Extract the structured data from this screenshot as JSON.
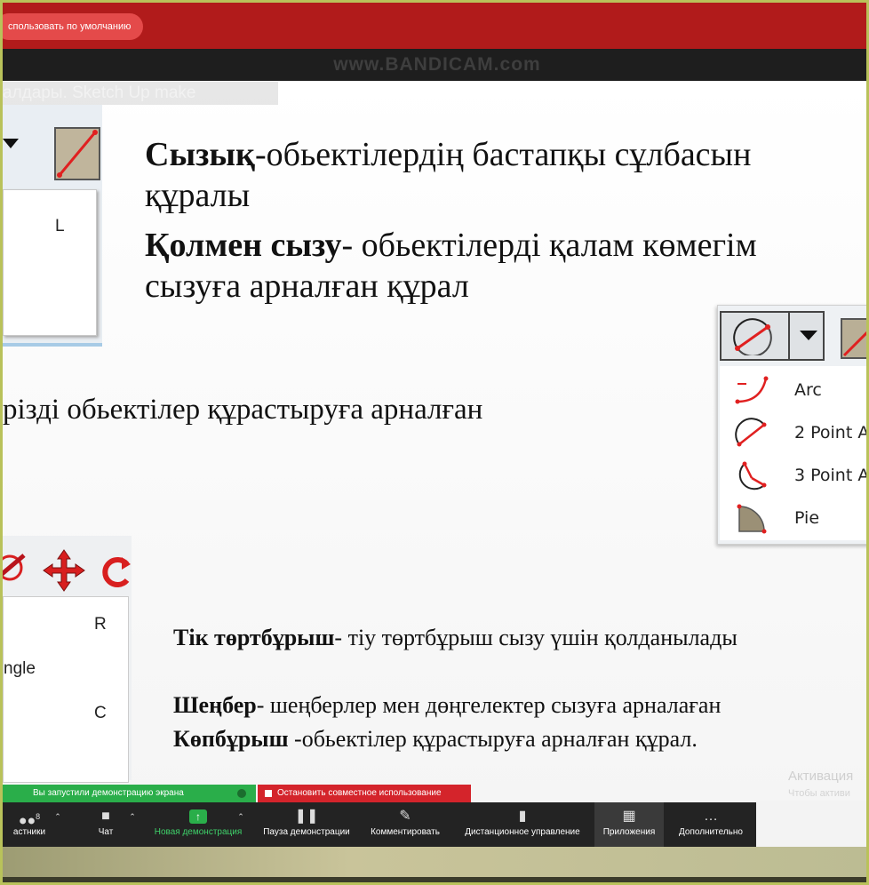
{
  "browser": {
    "pill_text": "спользовать по умолчанию",
    "watermark": "www.BANDICAM.com"
  },
  "slide": {
    "title": "алдары. Sketch Up make",
    "line1_bold": "Сызық",
    "line1_rest": "-обьектілердің бастапқы сұлбасын",
    "line2": "құралы",
    "line3_bold": "Қолмен сызу",
    "line3_rest": "- обьектілерді қалам көмегім",
    "line4": "сызуға арналған құрал",
    "mid_text": "різді обьектілер құрастыруға арналған",
    "rect_bold": "Тік төртбұрыш",
    "rect_rest": "- тіу төртбұрыш сызу үшін қолданылады",
    "circle_bold": "Шеңбер",
    "circle_rest": "- шеңберлер мен  дөңгелектер сызуға арналаған",
    "poly_bold": "Көпбұрыш",
    "poly_rest": " -обьектілер құрастыруға арналған құрал."
  },
  "line_tool_panel": {
    "shortcut": "L"
  },
  "arc_panel": {
    "items": [
      {
        "label": "Arc",
        "icon": "arc-icon"
      },
      {
        "label": "2 Point A",
        "icon": "two-point-arc-icon"
      },
      {
        "label": "3 Point A",
        "icon": "three-point-arc-icon"
      },
      {
        "label": "Pie",
        "icon": "pie-icon"
      }
    ]
  },
  "shape_panel": {
    "key_r": "R",
    "label_rect": "ngle",
    "key_c": "C"
  },
  "zoom": {
    "share_status": "Вы запустили демонстрацию экрана",
    "stop_share": "Остановить совместное использование",
    "participants_count": "8",
    "buttons": [
      {
        "label": "астники",
        "icon": "participants-icon"
      },
      {
        "label": "Чат",
        "icon": "chat-icon"
      },
      {
        "label": "Новая демонстрация",
        "icon": "new-share-icon"
      },
      {
        "label": "Пауза демонстрации",
        "icon": "pause-icon"
      },
      {
        "label": "Комментировать",
        "icon": "pencil-icon"
      },
      {
        "label": "Дистанционное управление",
        "icon": "remote-control-icon"
      },
      {
        "label": "Приложения",
        "icon": "apps-icon"
      },
      {
        "label": "Дополнительно",
        "icon": "more-icon"
      }
    ],
    "colors": {
      "green": "#2aae4a",
      "red": "#d4242b",
      "bar": "#232323"
    }
  },
  "windows_watermark": {
    "line1": "Активация",
    "line2": "Чтобы активи"
  }
}
